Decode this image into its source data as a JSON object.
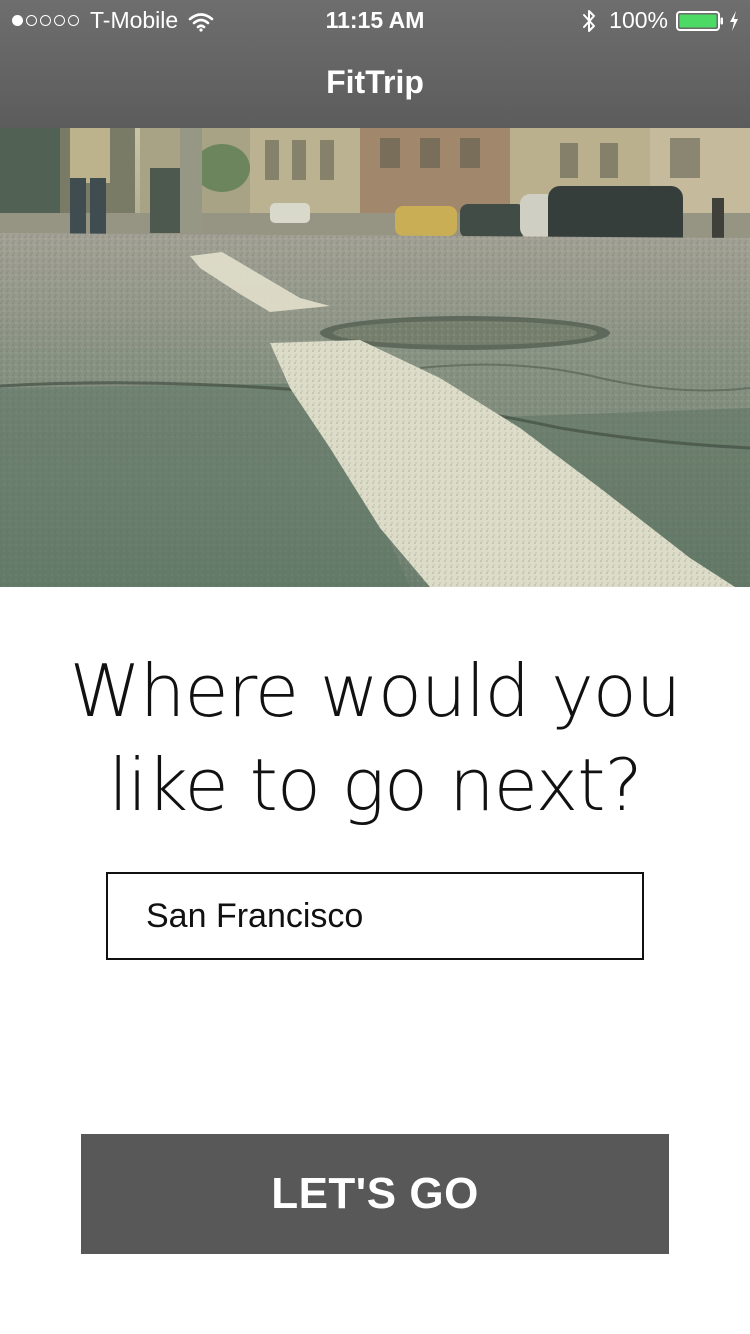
{
  "status_bar": {
    "carrier": "T-Mobile",
    "time": "11:15 AM",
    "battery_percent": "100%",
    "signal_bars_filled": 1,
    "signal_bars_total": 5,
    "battery_level": 1.0,
    "battery_color": "#4cd964"
  },
  "nav": {
    "title": "FitTrip"
  },
  "hero": {
    "image": "city-street-asphalt-photo"
  },
  "main": {
    "question_line1": "Where would you",
    "question_line2": "like to go next?",
    "destination_value": "San Francisco",
    "go_button_label": "LET'S GO"
  },
  "colors": {
    "header_bg": "#636363",
    "button_bg": "#585858",
    "text": "#111111"
  }
}
